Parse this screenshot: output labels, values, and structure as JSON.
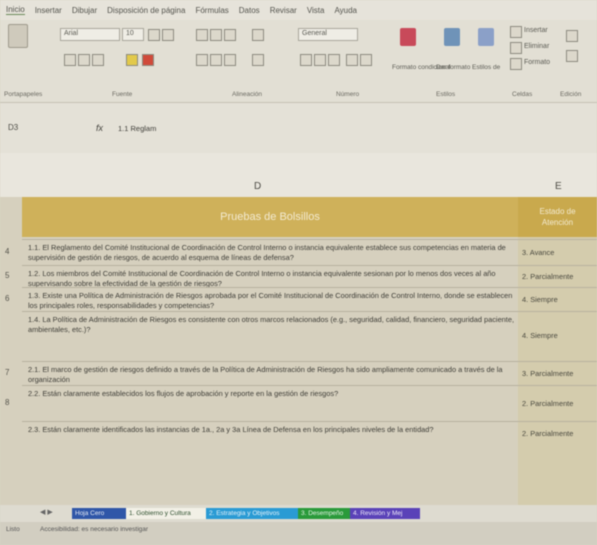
{
  "menu": [
    "Inicio",
    "Insertar",
    "Dibujar",
    "Disposición de página",
    "Fórmulas",
    "Datos",
    "Revisar",
    "Vista",
    "Ayuda"
  ],
  "ribbon": {
    "font_name": "Arial",
    "font_size": "10",
    "number_format": "General",
    "format_conditional": "Formato condicional",
    "format_table": "Dar formato como tabla",
    "cell_styles": "Estilos de celda",
    "insert": "Insertar",
    "delete": "Eliminar",
    "format": "Formato",
    "groups": [
      "Portapapeles",
      "Fuente",
      "Alineación",
      "Número",
      "Estilos",
      "Celdas",
      "Edición"
    ]
  },
  "formula_bar": {
    "name_box": "D3",
    "fx": "fx",
    "value": "1.1 Reglam"
  },
  "columns": {
    "d": "D",
    "e": "E"
  },
  "header": {
    "title": "Pruebas de Bolsillos",
    "col_e_line1": "Estado de",
    "col_e_line2": "Atención"
  },
  "rows": [
    {
      "num": "4",
      "text": "1.1. El Reglamento del Comité Institucional de Coordinación de Control Interno o instancia equivalente establece sus competencias en materia de supervisión de gestión de riesgos, de acuerdo al esquema de líneas de defensa?",
      "status": "3. Avance"
    },
    {
      "num": "5",
      "text": "1.2. Los miembros del Comité Institucional de Coordinación de Control Interno o instancia equivalente sesionan por lo menos dos veces al año supervisando sobre la efectividad de la gestión de riesgos?",
      "status": "2. Parcialmente"
    },
    {
      "num": "6",
      "text": "1.3. Existe una Política de Administración de Riesgos aprobada por el Comité Institucional de Coordinación de Control Interno, donde se establecen los principales roles, responsabilidades y competencias?",
      "status": "4. Siempre"
    },
    {
      "num": "",
      "text": "1.4. La Política de Administración de Riesgos es consistente con otros marcos relacionados (e.g., seguridad, calidad, financiero, seguridad paciente, ambientales, etc.)?",
      "status": "4. Siempre"
    },
    {
      "num": "7",
      "text": "2.1. El marco de gestión de riesgos definido a través de la Política de Administración de Riesgos ha sido ampliamente comunicado a través de la organización",
      "status": "3. Parcialmente"
    },
    {
      "num": "8",
      "text": "2.2. Están claramente establecidos los flujos de aprobación y reporte en la gestión de riesgos?",
      "status": "2. Parcialmente"
    },
    {
      "num": "",
      "text": "2.3. Están claramente identificados las instancias de 1a., 2a y 3a Línea de Defensa en los principales niveles de la entidad?",
      "status": "2. Parcialmente"
    }
  ],
  "tabs": [
    {
      "label": "Hoja Cero",
      "color": "#2f56a8",
      "text_color": "#e8ecf5"
    },
    {
      "label": "1. Gobierno y Cultura",
      "color": "#f2f0e6",
      "text_color": "#2e4f2e"
    },
    {
      "label": "2. Estrategia y Objetivos",
      "color": "#2a9bd4",
      "text_color": "#e6f2fa"
    },
    {
      "label": "3. Desempeño",
      "color": "#2a9a3a",
      "text_color": "#e4f3e4"
    },
    {
      "label": "4. Revisión y Mej",
      "color": "#5a42b8",
      "text_color": "#ece8f8"
    }
  ],
  "status": {
    "ready": "Listo",
    "accessibility": "Accesibilidad: es necesario investigar"
  }
}
